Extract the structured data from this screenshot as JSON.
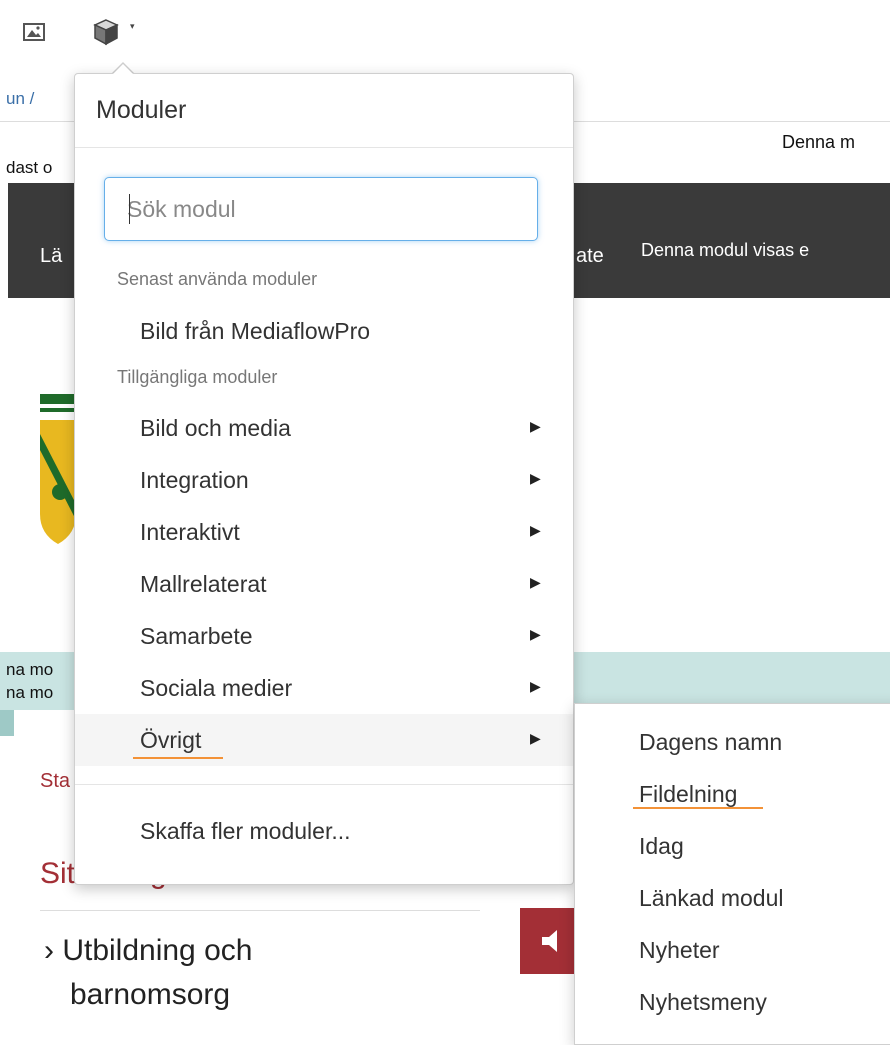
{
  "toolbar": {
    "image_icon": "image-icon",
    "module_icon": "cube-icon",
    "caret": "▾"
  },
  "background": {
    "breadcrumb_fragment": "un  /",
    "top_right_text": "Denna m",
    "left_text": "dast o",
    "band_left": "Lä",
    "band_mid": "ate",
    "band_right": "Denna modul visas e",
    "teal_line1": "na mo",
    "teal_line2": "na mo",
    "side_label": "Sta",
    "side_heading_left": "Sit",
    "side_heading_right": "g",
    "nav_item_line1": "› Utbildning och",
    "nav_item_line2": "barnomsorg"
  },
  "menu": {
    "title": "Moduler",
    "search": {
      "placeholder": "Sök modul",
      "value": ""
    },
    "recent_header": "Senast använda moduler",
    "recent_items": [
      "Bild från MediaflowPro"
    ],
    "available_header": "Tillgängliga moduler",
    "categories": [
      {
        "label": "Bild och media"
      },
      {
        "label": "Integration"
      },
      {
        "label": "Interaktivt"
      },
      {
        "label": "Mallrelaterat"
      },
      {
        "label": "Samarbete"
      },
      {
        "label": "Sociala medier"
      },
      {
        "label": "Övrigt"
      }
    ],
    "submenu_arrow": "▶",
    "more_link": "Skaffa fler moduler..."
  },
  "submenu": {
    "items": [
      "Dagens namn",
      "Fildelning",
      "Idag",
      "Länkad modul",
      "Nyheter",
      "Nyhetsmeny"
    ]
  },
  "colors": {
    "accent_underline": "#f39237",
    "dark_band": "#3a3a3a",
    "teal_band": "#c9e4e2",
    "red_block": "#a32f36"
  }
}
